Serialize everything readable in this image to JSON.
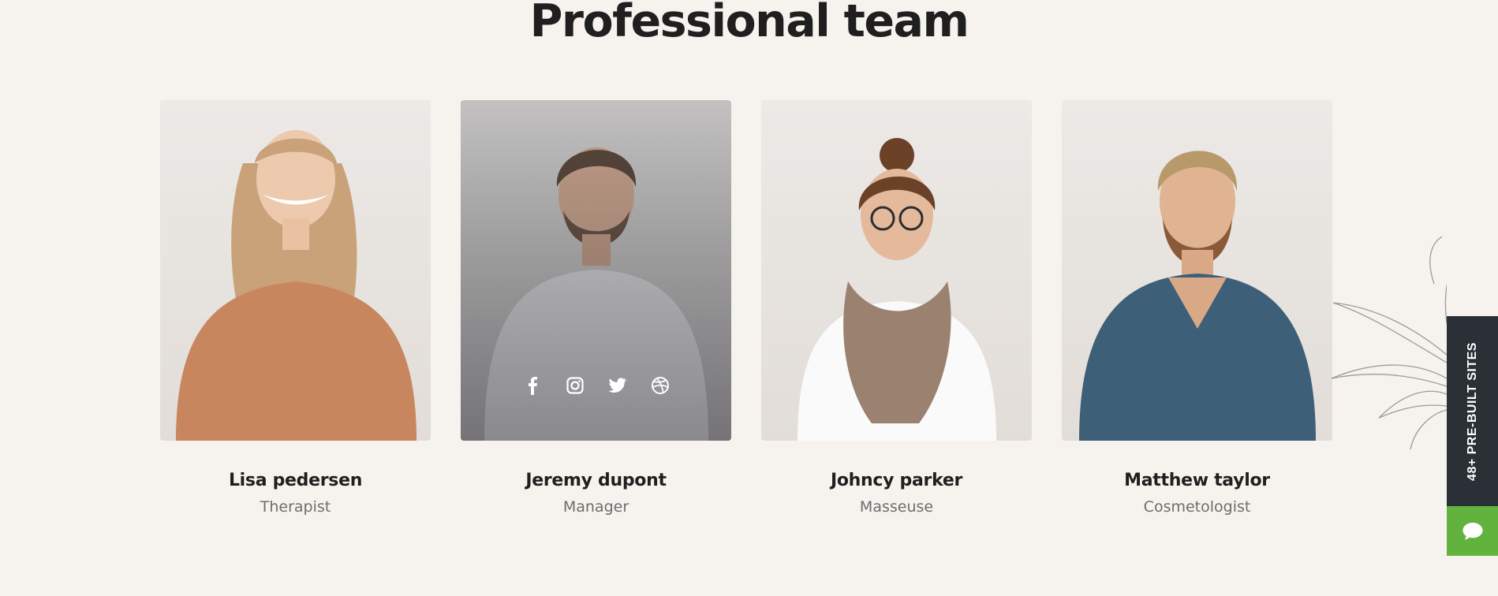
{
  "section": {
    "title": "Professional team"
  },
  "team": [
    {
      "name": "Lisa pedersen",
      "role": "Therapist"
    },
    {
      "name": "Jeremy dupont",
      "role": "Manager"
    },
    {
      "name": "Johncy parker",
      "role": "Masseuse"
    },
    {
      "name": "Matthew taylor",
      "role": "Cosmetologist"
    }
  ],
  "socials": [
    "facebook-icon",
    "instagram-icon",
    "twitter-icon",
    "dribbble-icon"
  ],
  "side_tab": {
    "label": "48+ PRE-BUILT SITES"
  },
  "colors": {
    "background": "#f6f3ef",
    "side_tab": "#2b2f36",
    "chat_button": "#61b33d"
  }
}
